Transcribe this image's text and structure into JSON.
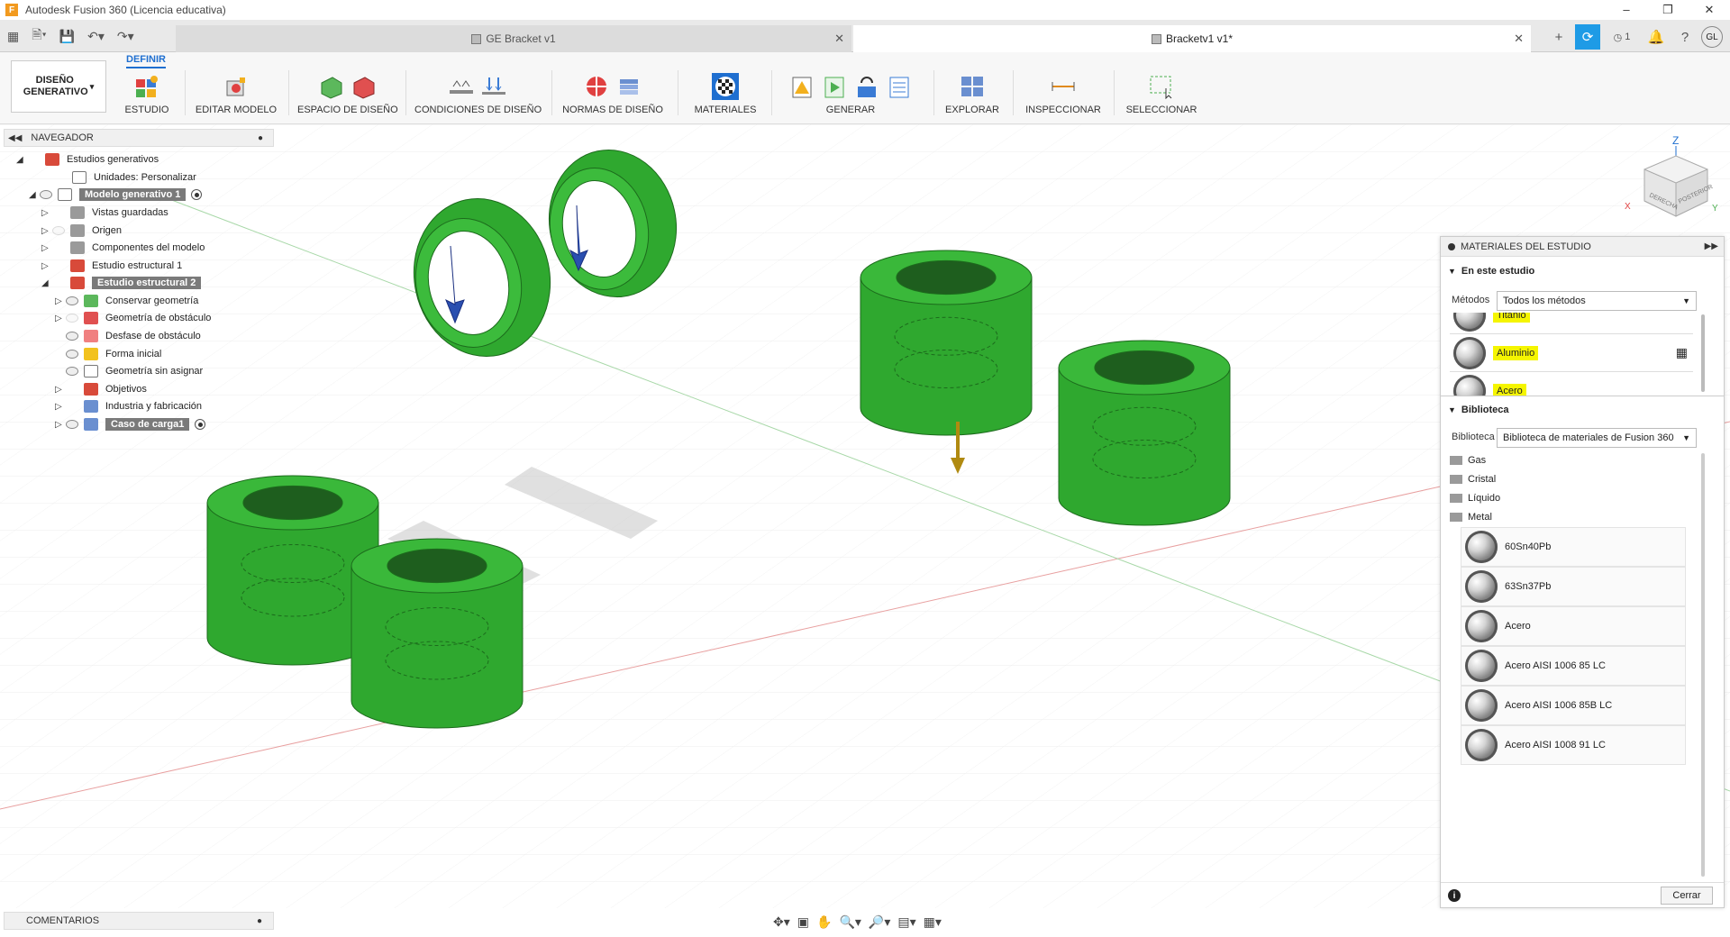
{
  "window": {
    "title": "Autodesk Fusion 360 (Licencia educativa)",
    "app_letter": "F"
  },
  "tabs": [
    {
      "label": "GE Bracket v1"
    },
    {
      "label": "Bracketv1 v1*"
    }
  ],
  "account": {
    "initials": "GL",
    "notif_count": "1"
  },
  "toolbar": {
    "workspace": "DISEÑO GENERATIVO",
    "active_tab": "DEFINIR",
    "groups": [
      "ESTUDIO",
      "EDITAR MODELO",
      "ESPACIO DE DISEÑO",
      "CONDICIONES DE DISEÑO",
      "NORMAS DE DISEÑO",
      "MATERIALES",
      "GENERAR",
      "EXPLORAR",
      "INSPECCIONAR",
      "SELECCIONAR"
    ]
  },
  "navigator": {
    "title": "NAVEGADOR",
    "items": [
      {
        "label": "Estudios generativos"
      },
      {
        "label": "Unidades: Personalizar"
      },
      {
        "label": "Modelo generativo 1"
      },
      {
        "label": "Vistas guardadas"
      },
      {
        "label": "Origen"
      },
      {
        "label": "Componentes del modelo"
      },
      {
        "label": "Estudio estructural 1"
      },
      {
        "label": "Estudio estructural 2"
      },
      {
        "label": "Conservar geometría"
      },
      {
        "label": "Geometría de obstáculo"
      },
      {
        "label": "Desfase de obstáculo"
      },
      {
        "label": "Forma inicial"
      },
      {
        "label": "Geometría sin asignar"
      },
      {
        "label": "Objetivos"
      },
      {
        "label": "Industria y fabricación"
      },
      {
        "label": "Caso de carga1"
      }
    ]
  },
  "materials_panel": {
    "title": "MATERIALES DEL ESTUDIO",
    "in_study_title": "En este estudio",
    "methods_label": "Métodos",
    "methods_value": "Todos los métodos",
    "study_materials": [
      "Titanio",
      "Aluminio",
      "Acero"
    ],
    "library_title": "Biblioteca",
    "library_label": "Biblioteca",
    "library_value": "Biblioteca de materiales de Fusion 360",
    "folders": [
      "Gas",
      "Cristal",
      "Líquido",
      "Metal"
    ],
    "library_materials": [
      "60Sn40Pb",
      "63Sn37Pb",
      "Acero",
      "Acero AISI 1006 85 LC",
      "Acero AISI 1006 85B LC",
      "Acero AISI 1008 91 LC"
    ],
    "close_label": "Cerrar",
    "info_icon": "i"
  },
  "comments": {
    "title": "COMENTARIOS"
  },
  "viewcube": {
    "top": "Z",
    "x": "X",
    "y": "Y",
    "face_right": "DERECHA",
    "face_back": "POSTERIOR"
  },
  "colors": {
    "part_green": "#2fa82f",
    "part_edge": "#1c6b1c",
    "accent_blue": "#1e9be6",
    "highlight": "#f5f500"
  }
}
